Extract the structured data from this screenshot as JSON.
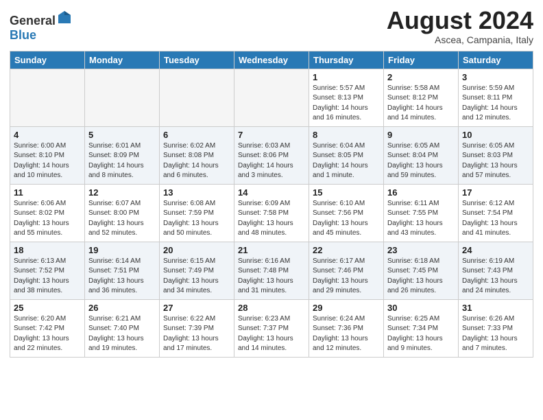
{
  "header": {
    "logo_general": "General",
    "logo_blue": "Blue",
    "month_title": "August 2024",
    "subtitle": "Ascea, Campania, Italy"
  },
  "days_of_week": [
    "Sunday",
    "Monday",
    "Tuesday",
    "Wednesday",
    "Thursday",
    "Friday",
    "Saturday"
  ],
  "weeks": [
    [
      {
        "day": "",
        "info": ""
      },
      {
        "day": "",
        "info": ""
      },
      {
        "day": "",
        "info": ""
      },
      {
        "day": "",
        "info": ""
      },
      {
        "day": "1",
        "info": "Sunrise: 5:57 AM\nSunset: 8:13 PM\nDaylight: 14 hours\nand 16 minutes."
      },
      {
        "day": "2",
        "info": "Sunrise: 5:58 AM\nSunset: 8:12 PM\nDaylight: 14 hours\nand 14 minutes."
      },
      {
        "day": "3",
        "info": "Sunrise: 5:59 AM\nSunset: 8:11 PM\nDaylight: 14 hours\nand 12 minutes."
      }
    ],
    [
      {
        "day": "4",
        "info": "Sunrise: 6:00 AM\nSunset: 8:10 PM\nDaylight: 14 hours\nand 10 minutes."
      },
      {
        "day": "5",
        "info": "Sunrise: 6:01 AM\nSunset: 8:09 PM\nDaylight: 14 hours\nand 8 minutes."
      },
      {
        "day": "6",
        "info": "Sunrise: 6:02 AM\nSunset: 8:08 PM\nDaylight: 14 hours\nand 6 minutes."
      },
      {
        "day": "7",
        "info": "Sunrise: 6:03 AM\nSunset: 8:06 PM\nDaylight: 14 hours\nand 3 minutes."
      },
      {
        "day": "8",
        "info": "Sunrise: 6:04 AM\nSunset: 8:05 PM\nDaylight: 14 hours\nand 1 minute."
      },
      {
        "day": "9",
        "info": "Sunrise: 6:05 AM\nSunset: 8:04 PM\nDaylight: 13 hours\nand 59 minutes."
      },
      {
        "day": "10",
        "info": "Sunrise: 6:05 AM\nSunset: 8:03 PM\nDaylight: 13 hours\nand 57 minutes."
      }
    ],
    [
      {
        "day": "11",
        "info": "Sunrise: 6:06 AM\nSunset: 8:02 PM\nDaylight: 13 hours\nand 55 minutes."
      },
      {
        "day": "12",
        "info": "Sunrise: 6:07 AM\nSunset: 8:00 PM\nDaylight: 13 hours\nand 52 minutes."
      },
      {
        "day": "13",
        "info": "Sunrise: 6:08 AM\nSunset: 7:59 PM\nDaylight: 13 hours\nand 50 minutes."
      },
      {
        "day": "14",
        "info": "Sunrise: 6:09 AM\nSunset: 7:58 PM\nDaylight: 13 hours\nand 48 minutes."
      },
      {
        "day": "15",
        "info": "Sunrise: 6:10 AM\nSunset: 7:56 PM\nDaylight: 13 hours\nand 45 minutes."
      },
      {
        "day": "16",
        "info": "Sunrise: 6:11 AM\nSunset: 7:55 PM\nDaylight: 13 hours\nand 43 minutes."
      },
      {
        "day": "17",
        "info": "Sunrise: 6:12 AM\nSunset: 7:54 PM\nDaylight: 13 hours\nand 41 minutes."
      }
    ],
    [
      {
        "day": "18",
        "info": "Sunrise: 6:13 AM\nSunset: 7:52 PM\nDaylight: 13 hours\nand 38 minutes."
      },
      {
        "day": "19",
        "info": "Sunrise: 6:14 AM\nSunset: 7:51 PM\nDaylight: 13 hours\nand 36 minutes."
      },
      {
        "day": "20",
        "info": "Sunrise: 6:15 AM\nSunset: 7:49 PM\nDaylight: 13 hours\nand 34 minutes."
      },
      {
        "day": "21",
        "info": "Sunrise: 6:16 AM\nSunset: 7:48 PM\nDaylight: 13 hours\nand 31 minutes."
      },
      {
        "day": "22",
        "info": "Sunrise: 6:17 AM\nSunset: 7:46 PM\nDaylight: 13 hours\nand 29 minutes."
      },
      {
        "day": "23",
        "info": "Sunrise: 6:18 AM\nSunset: 7:45 PM\nDaylight: 13 hours\nand 26 minutes."
      },
      {
        "day": "24",
        "info": "Sunrise: 6:19 AM\nSunset: 7:43 PM\nDaylight: 13 hours\nand 24 minutes."
      }
    ],
    [
      {
        "day": "25",
        "info": "Sunrise: 6:20 AM\nSunset: 7:42 PM\nDaylight: 13 hours\nand 22 minutes."
      },
      {
        "day": "26",
        "info": "Sunrise: 6:21 AM\nSunset: 7:40 PM\nDaylight: 13 hours\nand 19 minutes."
      },
      {
        "day": "27",
        "info": "Sunrise: 6:22 AM\nSunset: 7:39 PM\nDaylight: 13 hours\nand 17 minutes."
      },
      {
        "day": "28",
        "info": "Sunrise: 6:23 AM\nSunset: 7:37 PM\nDaylight: 13 hours\nand 14 minutes."
      },
      {
        "day": "29",
        "info": "Sunrise: 6:24 AM\nSunset: 7:36 PM\nDaylight: 13 hours\nand 12 minutes."
      },
      {
        "day": "30",
        "info": "Sunrise: 6:25 AM\nSunset: 7:34 PM\nDaylight: 13 hours\nand 9 minutes."
      },
      {
        "day": "31",
        "info": "Sunrise: 6:26 AM\nSunset: 7:33 PM\nDaylight: 13 hours\nand 7 minutes."
      }
    ]
  ]
}
